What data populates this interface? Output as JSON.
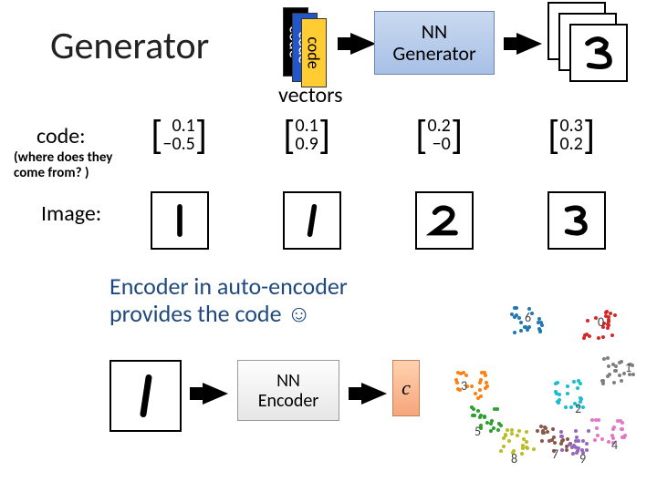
{
  "title": "Generator",
  "code_stack": {
    "labels": [
      "code",
      "code",
      "code"
    ]
  },
  "vectors_label": "vectors",
  "nn_generator": "NN\nGenerator",
  "code_section": {
    "label": "code:",
    "subnote": "(where does they\ncome from? )",
    "codes": [
      {
        "top": "0.1",
        "bot": "−0.5"
      },
      {
        "top": "0.1",
        "bot": "0.9"
      },
      {
        "top": "0.2",
        "bot": "−0"
      },
      {
        "top": "0.3",
        "bot": "0.2"
      }
    ]
  },
  "image_label": "Image:",
  "encoder_text": "Encoder in auto-encoder\nprovides the code ☺",
  "nn_encoder": "NN\nEncoder",
  "c_label": "c",
  "scatter": {
    "cluster_labels": [
      "0",
      "1",
      "2",
      "3",
      "4",
      "5",
      "6",
      "7",
      "8",
      "9"
    ]
  }
}
